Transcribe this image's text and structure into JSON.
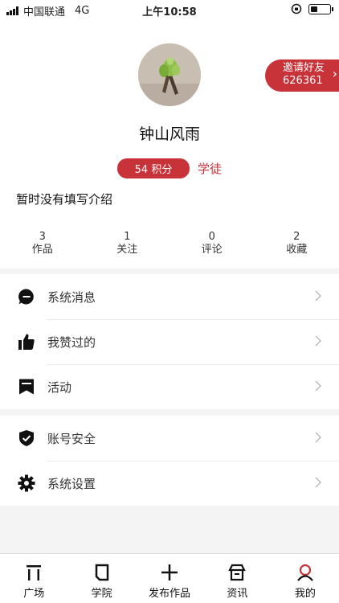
{
  "status_bar": {
    "carrier": "中国联通",
    "network": "4G",
    "time": "上午10:58",
    "battery_level": 0.35
  },
  "profile": {
    "invite_label": "邀请好友",
    "invite_code": "626361",
    "nickname": "钟山风雨",
    "points": "54 积分",
    "level": "学徒",
    "intro": "暂时没有填写介绍",
    "stats": [
      {
        "count": "3",
        "label": "作品"
      },
      {
        "count": "1",
        "label": "关注"
      },
      {
        "count": "0",
        "label": "评论"
      },
      {
        "count": "2",
        "label": "收藏"
      }
    ]
  },
  "menu": {
    "group1": [
      {
        "icon": "message-icon",
        "label": "系统消息"
      },
      {
        "icon": "thumbs-up-icon",
        "label": "我赞过的"
      },
      {
        "icon": "flag-icon",
        "label": "活动"
      }
    ],
    "group2": [
      {
        "icon": "shield-check-icon",
        "label": "账号安全"
      },
      {
        "icon": "gear-icon",
        "label": "系统设置"
      }
    ]
  },
  "tabbar": [
    {
      "icon": "plaza-icon",
      "label": "广场"
    },
    {
      "icon": "book-icon",
      "label": "学院"
    },
    {
      "icon": "plus-icon",
      "label": "发布作品"
    },
    {
      "icon": "store-icon",
      "label": "资讯"
    },
    {
      "icon": "person-icon",
      "label": "我的"
    }
  ],
  "colors": {
    "accent": "#c8333a"
  }
}
